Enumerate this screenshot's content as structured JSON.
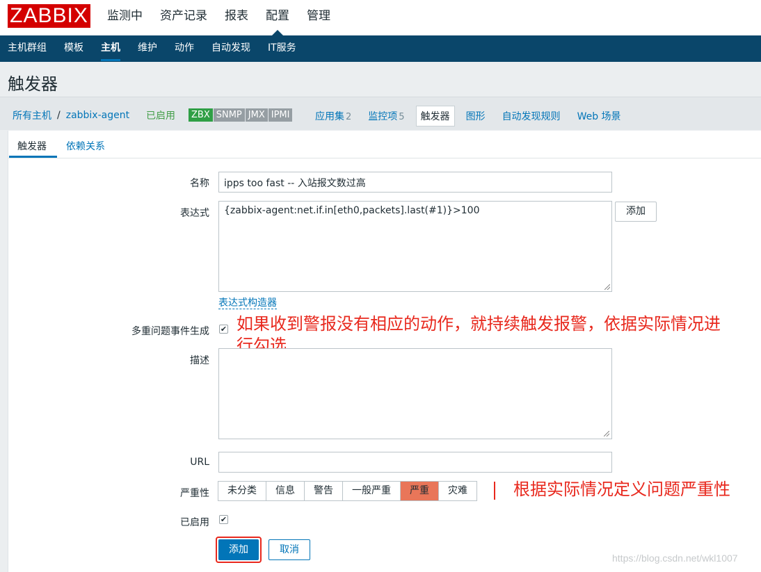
{
  "brand": {
    "logo_text": "ZABBIX",
    "color": "#d40000"
  },
  "top_menu": [
    {
      "label": "监测中"
    },
    {
      "label": "资产记录"
    },
    {
      "label": "报表"
    },
    {
      "label": "配置",
      "active": true
    },
    {
      "label": "管理"
    }
  ],
  "sub_menu": [
    {
      "label": "主机群组"
    },
    {
      "label": "模板"
    },
    {
      "label": "主机",
      "active": true
    },
    {
      "label": "维护"
    },
    {
      "label": "动作"
    },
    {
      "label": "自动发现"
    },
    {
      "label": "IT服务"
    }
  ],
  "page_title": "触发器",
  "breadcrumb": {
    "root": "所有主机",
    "separator": "/",
    "host": "zabbix-agent"
  },
  "host_status": "已启用",
  "availability": [
    "ZBX",
    "SNMP",
    "JMX",
    "IPMI"
  ],
  "host_tabs": [
    {
      "label": "应用集",
      "count": "2"
    },
    {
      "label": "监控项",
      "count": "5"
    },
    {
      "label": "触发器",
      "selected": true
    },
    {
      "label": "图形"
    },
    {
      "label": "自动发现规则"
    },
    {
      "label": "Web 场景"
    }
  ],
  "form_tabs": {
    "trigger": "触发器",
    "dependencies": "依赖关系"
  },
  "form": {
    "name_label": "名称",
    "name_value": "ipps too fast -- 入站报文数过高",
    "expression_label": "表达式",
    "expression_value": "{zabbix-agent:net.if.in[eth0,packets].last(#1)}>100",
    "expression_add_button": "添加",
    "expression_builder_link": "表达式构造器",
    "multiple_events_label": "多重问题事件生成",
    "multiple_events_checked": true,
    "description_label": "描述",
    "description_value": "",
    "url_label": "URL",
    "url_value": "",
    "severity_label": "严重性",
    "severity_options": [
      "未分类",
      "信息",
      "警告",
      "一般严重",
      "严重",
      "灾难"
    ],
    "severity_selected": "严重",
    "enabled_label": "已启用",
    "enabled_checked": true,
    "submit_button": "添加",
    "cancel_button": "取消"
  },
  "annotations": {
    "multiple_events_note_line1": "如果收到警报没有相应的动作，就持续触发报警，依据实际情况进",
    "multiple_events_note_line2": "行勾选",
    "severity_note": "根据实际情况定义问题严重性"
  },
  "watermark": "https://blog.csdn.net/wkl1007",
  "colors": {
    "nav_bg": "#0a466a",
    "link": "#0275b8",
    "enabled_green": "#429e47",
    "severity_selected": "#e97659",
    "annotation_red": "#e8281d"
  }
}
